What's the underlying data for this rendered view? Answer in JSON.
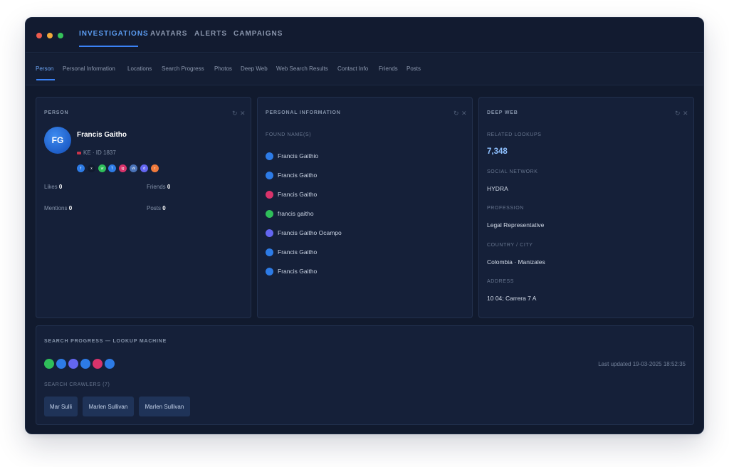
{
  "nav": {
    "tabs": [
      {
        "label": "INVESTIGATIONS",
        "active": true
      },
      {
        "label": "AVATARS"
      },
      {
        "label": "ALERTS"
      },
      {
        "label": "CAMPAIGNS"
      }
    ]
  },
  "subnav": {
    "tabs": [
      {
        "label": "Person",
        "active": true
      },
      {
        "label": "Personal Information"
      },
      {
        "label": "Locations"
      },
      {
        "label": "Search Progress"
      },
      {
        "label": "Photos"
      },
      {
        "label": "Deep Web"
      },
      {
        "label": "Web Search Results"
      },
      {
        "label": "Contact Info"
      },
      {
        "label": "Friends"
      },
      {
        "label": "Posts"
      }
    ]
  },
  "person": {
    "title": "PERSON",
    "initials": "FG",
    "name": "Francis Gaitho",
    "meta": "KE · ID 1837",
    "socials": [
      {
        "icon": "facebook-icon",
        "glyph": "f",
        "color": "#2d7be6"
      },
      {
        "icon": "x-icon",
        "glyph": "x",
        "color": "#111a2e"
      },
      {
        "icon": "whatsapp-icon",
        "glyph": "w",
        "color": "#2fbe5a"
      },
      {
        "icon": "telegram-icon",
        "glyph": "T",
        "color": "#2d7be6"
      },
      {
        "icon": "instagram-icon",
        "glyph": "ig",
        "color": "#d8336b"
      },
      {
        "icon": "vk-icon",
        "glyph": "vk",
        "color": "#4a73b8"
      },
      {
        "icon": "discord-icon",
        "glyph": "d",
        "color": "#6366f1"
      },
      {
        "icon": "reddit-icon",
        "glyph": "r",
        "color": "#f07a3c"
      }
    ],
    "stats": {
      "likes_label": "Likes",
      "likes": "0",
      "friends_label": "Friends",
      "friends": "0",
      "mentions_label": "Mentions",
      "mentions": "0",
      "posts_label": "Posts",
      "posts": "0"
    }
  },
  "personal_info": {
    "title": "PERSONAL INFORMATION",
    "found_label": "FOUND NAME(S)",
    "names": [
      {
        "name": "Francis Gaithio",
        "color": "#2d7be6"
      },
      {
        "name": "Francis Gaitho",
        "color": "#2d7be6"
      },
      {
        "name": "Francis Gaitho",
        "color": "#d8336b"
      },
      {
        "name": "francis gaitho",
        "color": "#2fbe5a"
      },
      {
        "name": "Francis Gaitho Ocampo",
        "color": "#6366f1"
      },
      {
        "name": "Francis Gaitho",
        "color": "#2d7be6"
      },
      {
        "name": "Francis Gaitho",
        "color": "#2d7be6"
      }
    ]
  },
  "deep_web": {
    "title": "DEEP WEB",
    "related_label": "RELATED LOOKUPS",
    "related_value": "7,348",
    "social_label": "SOCIAL NETWORK",
    "social_value": "HYDRA",
    "profession_label": "PROFESSION",
    "profession_value": "Legal Representative",
    "country_label": "COUNTRY / CITY",
    "country_value": "Colombia · Manizales",
    "address_label": "ADDRESS",
    "address_value": "10 04; Carrera 7 A"
  },
  "search_progress": {
    "title": "SEARCH PROGRESS — LOOKUP MACHINE",
    "dots": [
      "#2fbe5a",
      "#2d7be6",
      "#6366f1",
      "#2d7be6",
      "#d8336b",
      "#2d7be6"
    ],
    "updated": "Last updated 19-03-2025 18:52:35",
    "crawlers_label": "SEARCH CRAWLERS (7)",
    "crawlers": [
      "Mar Sulli",
      "Marlen Sullivan",
      "Marlen Sullivan"
    ]
  },
  "controls": {
    "refresh": "↻",
    "close": "✕"
  }
}
